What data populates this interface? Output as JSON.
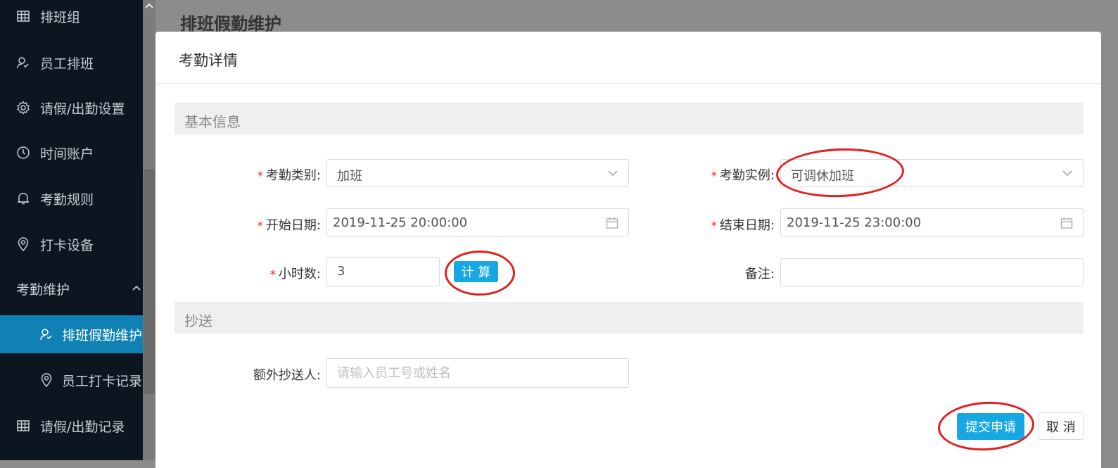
{
  "sidebar": {
    "items": [
      {
        "label": "排班组",
        "icon": "table-icon"
      },
      {
        "label": "员工排班",
        "icon": "user-schedule-icon"
      },
      {
        "label": "请假/出勤设置",
        "icon": "gear-icon"
      },
      {
        "label": "时间账户",
        "icon": "clock-icon"
      },
      {
        "label": "考勤规则",
        "icon": "bell-icon"
      },
      {
        "label": "打卡设备",
        "icon": "location-icon"
      }
    ],
    "group": {
      "label": "考勤维护",
      "icon": "chevron-up-icon"
    },
    "sub_items": [
      {
        "label": "排班假勤维护",
        "icon": "user-schedule-icon",
        "active": true
      },
      {
        "label": "员工打卡记录",
        "icon": "location-icon",
        "active": false
      }
    ],
    "bottom_item": {
      "label": "请假/出勤记录",
      "icon": "table-icon"
    }
  },
  "page": {
    "title": "排班假勤维护"
  },
  "modal": {
    "title": "考勤详情",
    "section_basic": "基本信息",
    "section_cc": "抄送",
    "fields": {
      "category": {
        "label": "考勤类别:",
        "value": "加班",
        "required": "*"
      },
      "instance": {
        "label": "考勤实例:",
        "value": "可调休加班",
        "required": "*"
      },
      "start_date": {
        "label": "开始日期:",
        "value": "2019-11-25 20:00:00",
        "required": "*"
      },
      "end_date": {
        "label": "结束日期:",
        "value": "2019-11-25 23:00:00",
        "required": "*"
      },
      "hours": {
        "label": "小时数:",
        "value": "3",
        "required": "*"
      },
      "remark": {
        "label": "备注:",
        "value": ""
      },
      "extra_cc": {
        "label": "额外抄送人:",
        "placeholder": "请输入员工号或姓名"
      }
    },
    "calc_button": "计 算",
    "submit_button": "提交申请",
    "cancel_button": "取 消"
  },
  "colors": {
    "primary": "#17a8e3",
    "sidebar_bg": "#0b1621",
    "sidebar_active": "#0f81b5",
    "required": "#e2231a",
    "annotation_ring": "#e31f1f"
  }
}
